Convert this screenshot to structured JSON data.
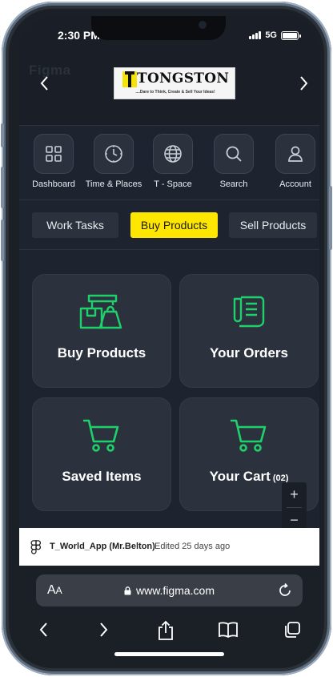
{
  "status": {
    "time": "2:30 PM",
    "network": "5G"
  },
  "header": {
    "watermark": "Figma",
    "logo_text": "TONGSTON",
    "logo_letter": "T",
    "logo_tagline": "....Dare to Think, Create & Sell Your Ideas!"
  },
  "nav": {
    "items": [
      {
        "label": "Dashboard",
        "icon": "dashboard-grid-icon"
      },
      {
        "label": "Time & Places",
        "icon": "clock-icon"
      },
      {
        "label": "T - Space",
        "icon": "globe-icon"
      },
      {
        "label": "Search",
        "icon": "search-icon"
      },
      {
        "label": "Account",
        "icon": "user-icon"
      }
    ]
  },
  "tabs": [
    {
      "label": "Work Tasks",
      "active": false
    },
    {
      "label": "Buy Products",
      "active": true
    },
    {
      "label": "Sell Products",
      "active": false
    }
  ],
  "cards": [
    {
      "label": "Buy Products",
      "icon": "shop-bag-icon"
    },
    {
      "label": "Your Orders",
      "icon": "receipt-icon"
    },
    {
      "label": "Saved Items",
      "icon": "cart-icon"
    },
    {
      "label": "Your Cart",
      "count": "(02)",
      "icon": "cart-icon"
    }
  ],
  "zoom": {
    "in": "+",
    "out": "−"
  },
  "figma_bar": {
    "file_name": "T_World_App (Mr.Belton)",
    "edited": "Edited 25 days ago"
  },
  "browser": {
    "aa_big": "A",
    "aa_small": "A",
    "url": "www.figma.com"
  },
  "colors": {
    "accent_yellow": "#ffe600",
    "icon_green": "#1fd16b",
    "background": "#1d2430",
    "card": "#2b323d"
  }
}
